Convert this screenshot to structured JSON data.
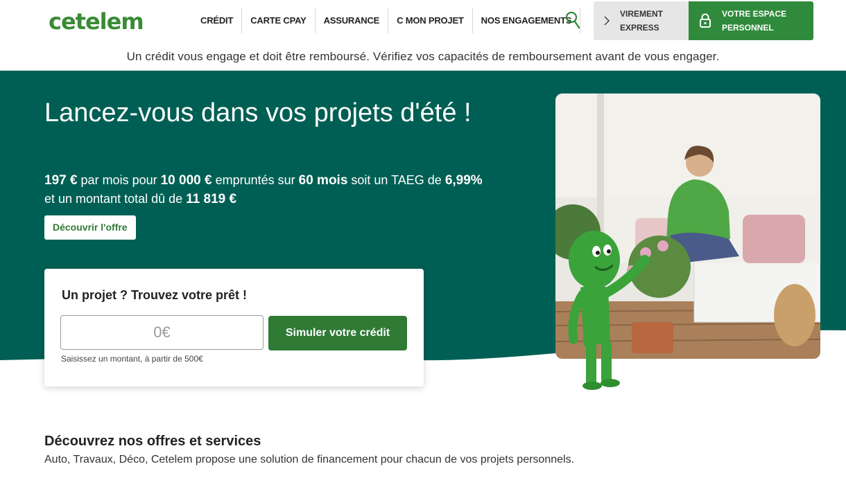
{
  "header": {
    "logo": "cetelem",
    "nav": [
      {
        "label": "CRÉDIT"
      },
      {
        "label": "CARTE CPAY"
      },
      {
        "label": "ASSURANCE"
      },
      {
        "label": "C MON PROJET"
      },
      {
        "label": "NOS ENGAGEMENTS"
      }
    ],
    "virement_line1": "VIREMENT",
    "virement_line2": "EXPRESS",
    "espace_line1": "VOTRE ESPACE",
    "espace_line2": "PERSONNEL",
    "icons": {
      "search": "search-icon",
      "chevron": "chevron-right-icon",
      "lock": "lock-icon"
    }
  },
  "disclaimer": "Un crédit vous engage et doit être remboursé. Vérifiez vos capacités de remboursement avant de vous engager.",
  "hero": {
    "title": "Lancez-vous dans vos projets d'été !",
    "desc": {
      "monthly": "197 €",
      "t1": " par mois pour ",
      "amount": "10 000 €",
      "t2": " empruntés sur ",
      "duration": "60 mois",
      "t3": " soit un TAEG de ",
      "taeg": "6,99%",
      "t4": " et un montant total dû de ",
      "total": "11 819 €"
    },
    "offer_button": "Découvrir l'offre"
  },
  "simulator": {
    "title": "Un projet ? Trouvez votre prêt !",
    "input_value": "",
    "input_placeholder": "0€",
    "button": "Simuler votre crédit",
    "hint": "Saisissez un montant, à partir de 500€"
  },
  "offers": {
    "title": "Découvrez nos offres et services",
    "subtitle": "Auto, Travaux, Déco, Cetelem propose une solution de financement pour chacun de vos projets personnels."
  },
  "colors": {
    "brand_green": "#3a8a36",
    "hero_bg": "#005f54",
    "button_green": "#2f7a35",
    "espace_green": "#2f8a3b"
  }
}
